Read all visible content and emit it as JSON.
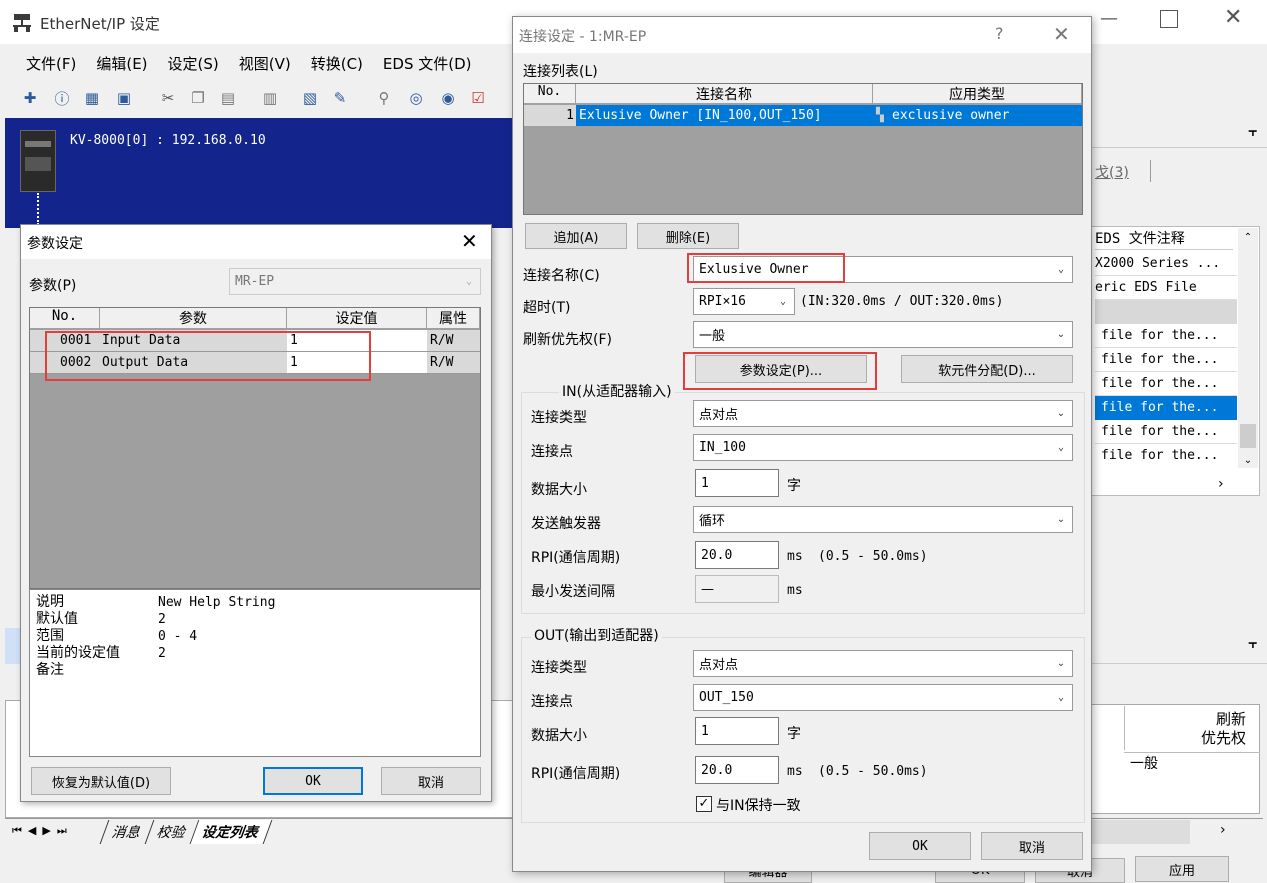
{
  "main": {
    "title": "EtherNet/IP 设定",
    "menu": [
      "文件(F)",
      "编辑(E)",
      "设定(S)",
      "视图(V)",
      "转换(C)",
      "EDS 文件(D)"
    ],
    "device_label": "KV-8000[0] : 192.168.0.10",
    "tab_frag": "戈(3)",
    "pin": "ᵽ",
    "right_header": "EDS 文件注释",
    "right_rows": [
      "X2000 Series ...",
      "eric EDS File",
      "",
      "file for the...",
      "file for the...",
      "file for the...",
      "file for the...",
      "file for the...",
      "file for the..."
    ],
    "bottom_hdr": [
      "刷新",
      "优先权"
    ],
    "bottom_val": "一般",
    "bottom_tabs": [
      "消息",
      "校验",
      "设定列表"
    ],
    "bottom_btns": [
      "编辑器",
      "OK",
      "取消",
      "应用"
    ]
  },
  "param": {
    "title": "参数设定",
    "param_label": "参数(P)",
    "param_value": "MR-EP",
    "headers": [
      "No.",
      "参数",
      "设定值",
      "属性"
    ],
    "rows": [
      {
        "no": "0001",
        "name": "Input Data",
        "val": "1",
        "attr": "R/W"
      },
      {
        "no": "0002",
        "name": "Output Data",
        "val": "1",
        "attr": "R/W"
      }
    ],
    "info_keys": [
      "说明",
      "默认值",
      "范围",
      "当前的设定值",
      "备注"
    ],
    "info_vals": [
      "New Help String",
      "2",
      "0 - 4",
      "2",
      ""
    ],
    "btn_default": "恢复为默认值(D)",
    "btn_ok": "OK",
    "btn_cancel": "取消"
  },
  "conn": {
    "title": "连接设定 - 1:MR-EP",
    "help": "?",
    "list_label": "连接列表(L)",
    "headers": [
      "No.",
      "连接名称",
      "应用类型"
    ],
    "row": {
      "no": "1",
      "name": "Exlusive Owner [IN_100,OUT_150]",
      "type": "exclusive owner"
    },
    "btn_add": "追加(A)",
    "btn_del": "删除(E)",
    "name_label": "连接名称(C)",
    "name_value": "Exlusive Owner",
    "timeout_label": "超时(T)",
    "timeout_value": "RPI×16",
    "timeout_info": "(IN:320.0ms / OUT:320.0ms)",
    "priority_label": "刷新优先权(F)",
    "priority_value": "一般",
    "btn_param": "参数设定(P)...",
    "btn_soft": "软元件分配(D)...",
    "in_group": "IN(从适配器输入)",
    "in": {
      "type_label": "连接类型",
      "type": "点对点",
      "point_label": "连接点",
      "point": "IN_100",
      "size_label": "数据大小",
      "size": "1",
      "unit": "字",
      "trig_label": "发送触发器",
      "trig": "循环",
      "rpi_label": "RPI(通信周期)",
      "rpi": "20.0",
      "ms": "ms",
      "range": "(0.5 - 50.0ms)",
      "min_label": "最小发送间隔",
      "min": "—"
    },
    "out_group": "OUT(输出到适配器)",
    "out": {
      "type_label": "连接类型",
      "type": "点对点",
      "point_label": "连接点",
      "point": "OUT_150",
      "size_label": "数据大小",
      "size": "1",
      "unit": "字",
      "rpi_label": "RPI(通信周期)",
      "rpi": "20.0",
      "ms": "ms",
      "range": "(0.5 - 50.0ms)",
      "sync": "与IN保持一致"
    },
    "btn_ok": "OK",
    "btn_cancel": "取消"
  }
}
